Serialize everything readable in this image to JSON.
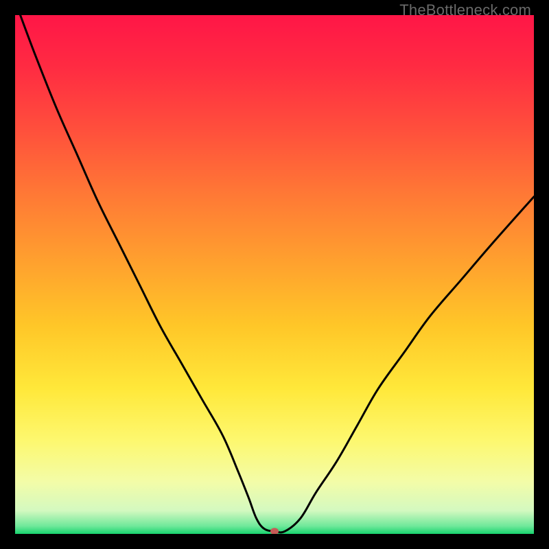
{
  "watermark": "TheBottleneck.com",
  "chart_data": {
    "type": "line",
    "title": "",
    "xlabel": "",
    "ylabel": "",
    "xlim": [
      0,
      100
    ],
    "ylim": [
      0,
      100
    ],
    "background_gradient": {
      "stops": [
        {
          "offset": 0.0,
          "color": "#ff1647"
        },
        {
          "offset": 0.1,
          "color": "#ff2b42"
        },
        {
          "offset": 0.22,
          "color": "#ff4f3c"
        },
        {
          "offset": 0.35,
          "color": "#ff7a35"
        },
        {
          "offset": 0.48,
          "color": "#ffa22e"
        },
        {
          "offset": 0.6,
          "color": "#ffc728"
        },
        {
          "offset": 0.72,
          "color": "#ffe83a"
        },
        {
          "offset": 0.82,
          "color": "#fdf86f"
        },
        {
          "offset": 0.9,
          "color": "#f3fca8"
        },
        {
          "offset": 0.955,
          "color": "#d4f9c0"
        },
        {
          "offset": 0.985,
          "color": "#6fe89a"
        },
        {
          "offset": 1.0,
          "color": "#17d36e"
        }
      ]
    },
    "series": [
      {
        "name": "bottleneck-curve",
        "color": "#000000",
        "x": [
          1,
          4,
          8,
          12,
          16,
          20,
          24,
          28,
          32,
          36,
          40,
          43,
          45,
          46.5,
          48,
          50,
          52,
          55,
          58,
          62,
          66,
          70,
          75,
          80,
          86,
          92,
          100
        ],
        "y": [
          100,
          92,
          82,
          73,
          64,
          56,
          48,
          40,
          33,
          26,
          19,
          12,
          7,
          3,
          1,
          0.5,
          0.5,
          3,
          8,
          14,
          21,
          28,
          35,
          42,
          49,
          56,
          65
        ]
      }
    ],
    "markers": [
      {
        "name": "min-point",
        "x": 50,
        "y": 0.5,
        "color": "#c75a56",
        "rx": 6,
        "ry": 5
      }
    ]
  }
}
